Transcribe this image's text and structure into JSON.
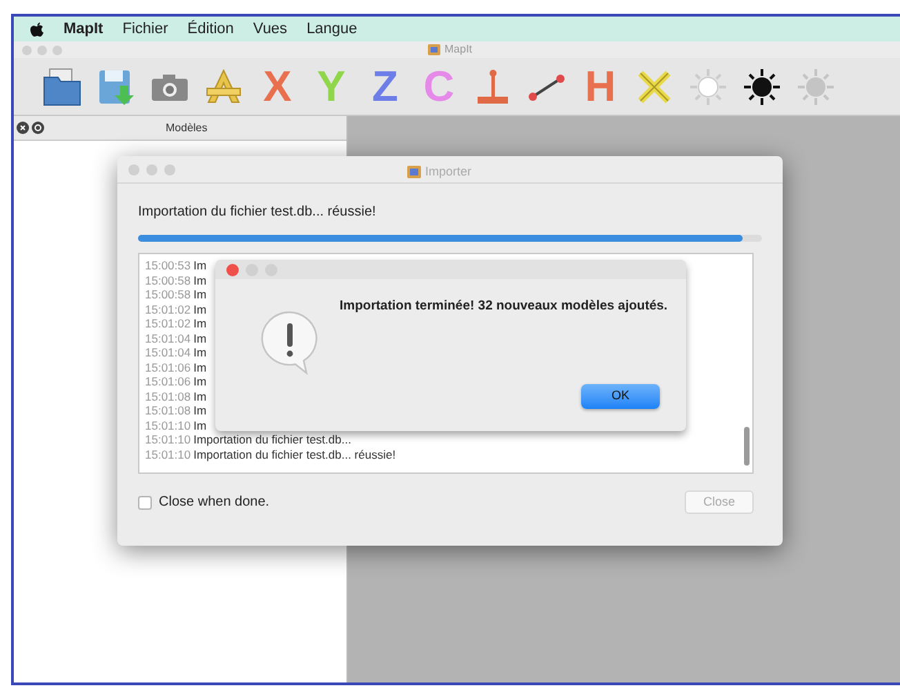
{
  "menu_bar": {
    "app_name": "MapIt",
    "items": [
      "Fichier",
      "Édition",
      "Vues",
      "Langue"
    ]
  },
  "window": {
    "title": "MapIt"
  },
  "toolbar": [
    {
      "kind": "folder"
    },
    {
      "kind": "save"
    },
    {
      "kind": "camera"
    },
    {
      "kind": "ruler-a"
    },
    {
      "kind": "letter",
      "label": "X",
      "color": "#e8704f"
    },
    {
      "kind": "letter",
      "label": "Y",
      "color": "#8fd64a"
    },
    {
      "kind": "letter",
      "label": "Z",
      "color": "#6d7ee8"
    },
    {
      "kind": "letter",
      "label": "C",
      "color": "#e58ae8"
    },
    {
      "kind": "perpendicular"
    },
    {
      "kind": "segment"
    },
    {
      "kind": "letter",
      "label": "H",
      "color": "#e8704f"
    },
    {
      "kind": "cross"
    },
    {
      "kind": "sun-white"
    },
    {
      "kind": "sun-black"
    },
    {
      "kind": "sun-gray"
    }
  ],
  "sidebar": {
    "title": "Modèles"
  },
  "importer": {
    "title": "Importer",
    "status": "Importation du fichier test.db... réussie!",
    "progress": {
      "level": 0.97
    },
    "log": [
      {
        "time": "15:00:53",
        "text": "Im"
      },
      {
        "time": "15:00:58",
        "text": "Im"
      },
      {
        "time": "15:00:58",
        "text": "Im"
      },
      {
        "time": "15:01:02",
        "text": "Im"
      },
      {
        "time": "15:01:02",
        "text": "Im"
      },
      {
        "time": "15:01:04",
        "text": "Im"
      },
      {
        "time": "15:01:04",
        "text": "Im"
      },
      {
        "time": "15:01:06",
        "text": "Im"
      },
      {
        "time": "15:01:06",
        "text": "Im"
      },
      {
        "time": "15:01:08",
        "text": "Im"
      },
      {
        "time": "15:01:08",
        "text": "Im"
      },
      {
        "time": "15:01:10",
        "text": "Im"
      },
      {
        "time": "15:01:10",
        "text": "Importation du fichier test.db..."
      },
      {
        "time": "15:01:10",
        "text": "Importation du fichier test.db... réussie!"
      }
    ],
    "close_when_done": {
      "label": "Close when done.",
      "checked": false
    },
    "close_button": {
      "label": "Close",
      "disabled": true
    }
  },
  "alert": {
    "message": "Importation terminée! 32 nouveaux modèles ajoutés.",
    "button": "OK"
  }
}
